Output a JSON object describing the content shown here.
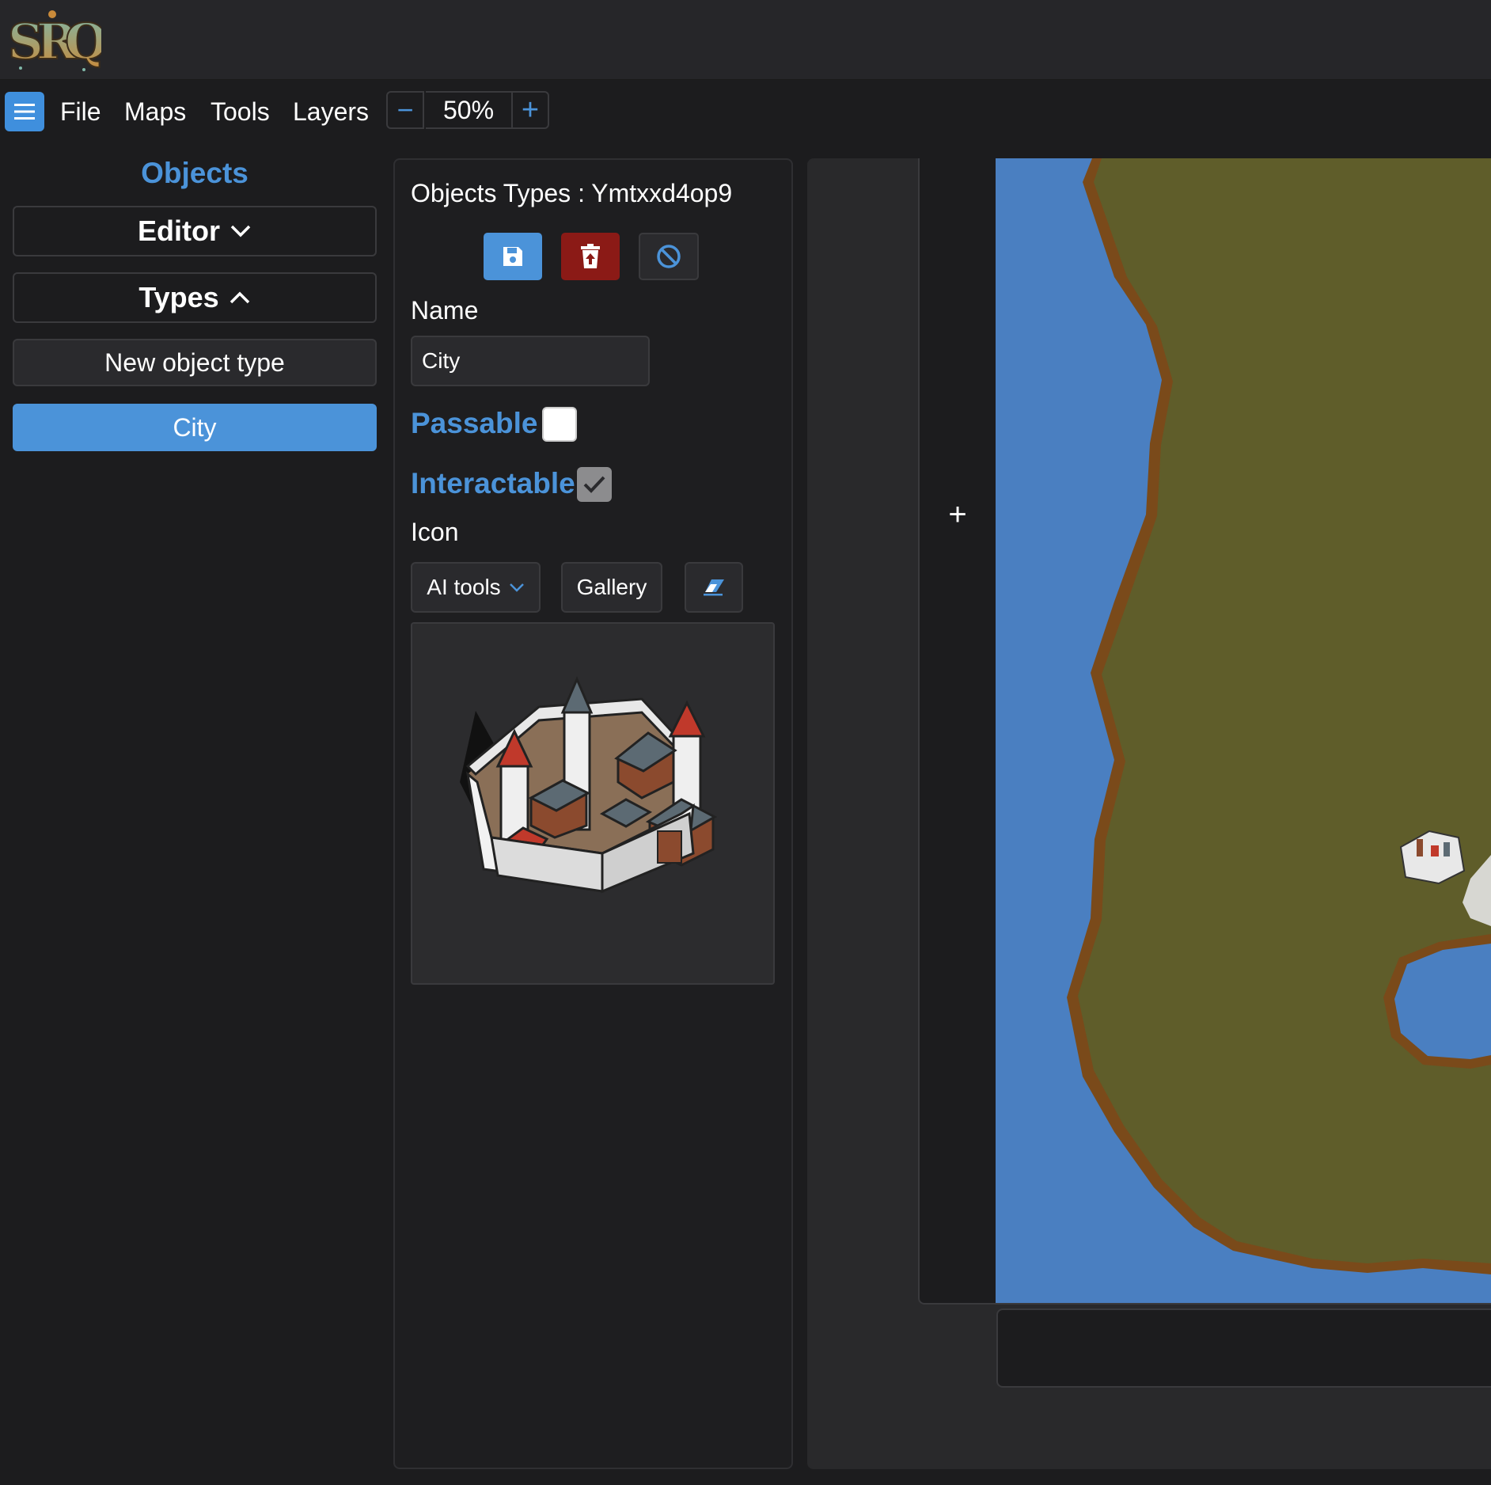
{
  "menu": {
    "items": [
      "File",
      "Maps",
      "Tools",
      "Layers"
    ],
    "zoom": "50%",
    "zoom_out_label": "−",
    "zoom_in_label": "+"
  },
  "left": {
    "heading": "Objects",
    "editor_label": "Editor",
    "types_label": "Types",
    "new_type_label": "New object type",
    "items": [
      {
        "label": "City",
        "active": true
      }
    ]
  },
  "editor": {
    "title": "Objects Types : Ymtxxd4op9",
    "name_label": "Name",
    "name_value": "City",
    "passable_label": "Passable",
    "passable_checked": false,
    "interactable_label": "Interactable",
    "interactable_checked": true,
    "icon_label": "Icon",
    "ai_tools_label": "AI tools",
    "gallery_label": "Gallery"
  },
  "map": {
    "add_label": "+"
  },
  "colors": {
    "accent": "#4b93d9",
    "danger": "#8b1a16",
    "background": "#1c1c1e",
    "water": "#4a7fc1",
    "grass": "#5f5d2a",
    "shore": "#7a4a1a"
  }
}
